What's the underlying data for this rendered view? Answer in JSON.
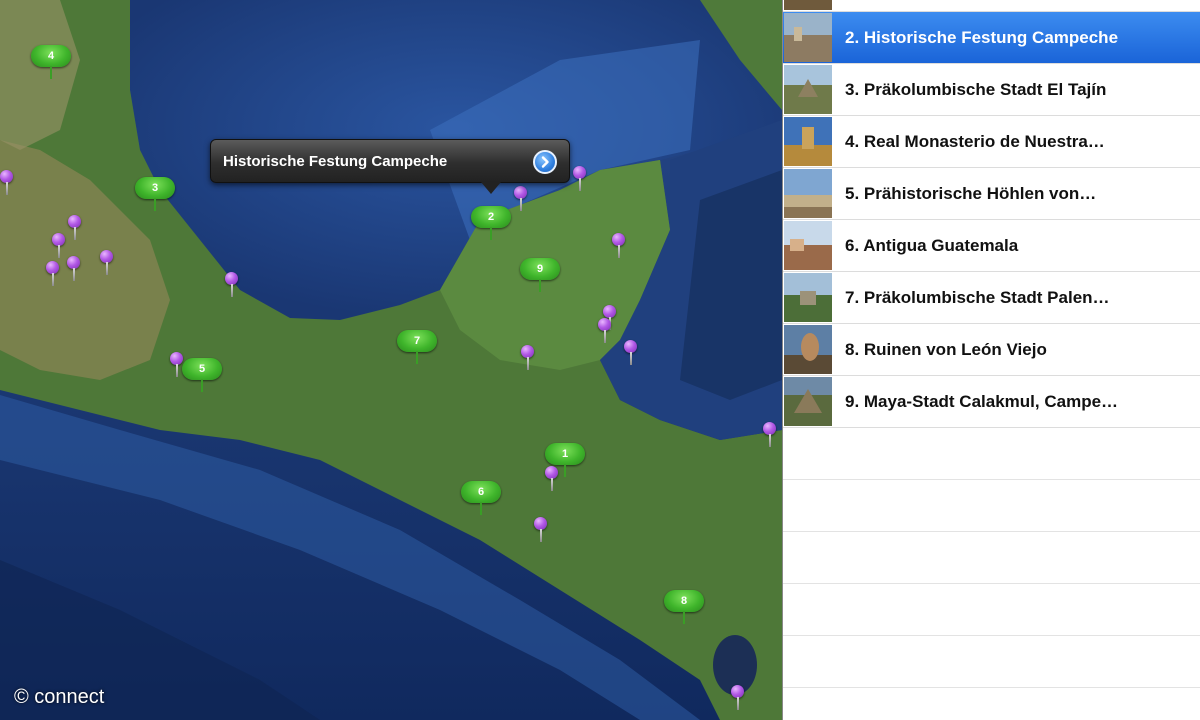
{
  "map": {
    "callout": {
      "title": "Historische Festung Campeche",
      "disclosure_icon": "chevron-right-circle-icon"
    },
    "green_pins": [
      "1",
      "2",
      "3",
      "4",
      "5",
      "6",
      "7",
      "8",
      "9"
    ],
    "copyright": "© connect"
  },
  "list": {
    "selected_index": 1,
    "items": [
      {
        "label": ""
      },
      {
        "label": "2. Historische Festung Campeche"
      },
      {
        "label": "3. Präkolumbische Stadt El Tajín"
      },
      {
        "label": "4. Real Monasterio de Nuestra…"
      },
      {
        "label": "5. Prähistorische Höhlen von…"
      },
      {
        "label": "6. Antigua Guatemala"
      },
      {
        "label": "7. Präkolumbische Stadt Palen…"
      },
      {
        "label": "8. Ruinen von León Viejo"
      },
      {
        "label": "9. Maya-Stadt Calakmul, Campe…"
      }
    ]
  },
  "colors": {
    "ocean": "#1f3f7a",
    "land": "#4f7a3a",
    "selection": "#1a64d8",
    "pin_green": "#3fb52b",
    "pin_purple": "#b259e6"
  }
}
